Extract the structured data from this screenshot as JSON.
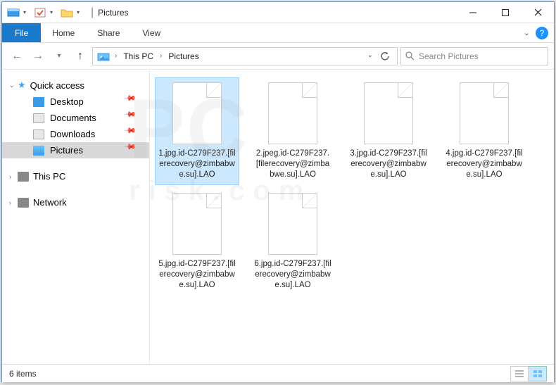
{
  "window": {
    "title": "Pictures",
    "separator": "|"
  },
  "ribbon": {
    "file": "File",
    "tabs": [
      "Home",
      "Share",
      "View"
    ]
  },
  "breadcrumb": {
    "items": [
      "This PC",
      "Pictures"
    ]
  },
  "search": {
    "placeholder": "Search Pictures"
  },
  "sidebar": {
    "quick_access": "Quick access",
    "items": [
      {
        "label": "Desktop",
        "pinned": true,
        "icon": "desktop"
      },
      {
        "label": "Documents",
        "pinned": true,
        "icon": "docs"
      },
      {
        "label": "Downloads",
        "pinned": true,
        "icon": "dl"
      },
      {
        "label": "Pictures",
        "pinned": true,
        "icon": "pic",
        "selected": true
      }
    ],
    "this_pc": "This PC",
    "network": "Network"
  },
  "files": [
    {
      "name": "1.jpg.id-C279F237.[filerecovery@zimbabwe.su].LAO",
      "selected": true
    },
    {
      "name": "2.jpeg.id-C279F237.[filerecovery@zimbabwe.su].LAO"
    },
    {
      "name": "3.jpg.id-C279F237.[filerecovery@zimbabwe.su].LAO"
    },
    {
      "name": "4.jpg.id-C279F237.[filerecovery@zimbabwe.su].LAO"
    },
    {
      "name": "5.jpg.id-C279F237.[filerecovery@zimbabwe.su].LAO"
    },
    {
      "name": "6.jpg.id-C279F237.[filerecovery@zimbabwe.su].LAO"
    }
  ],
  "status": {
    "count": "6 items"
  },
  "watermark": {
    "big": "PC",
    "small": "risk.com"
  }
}
